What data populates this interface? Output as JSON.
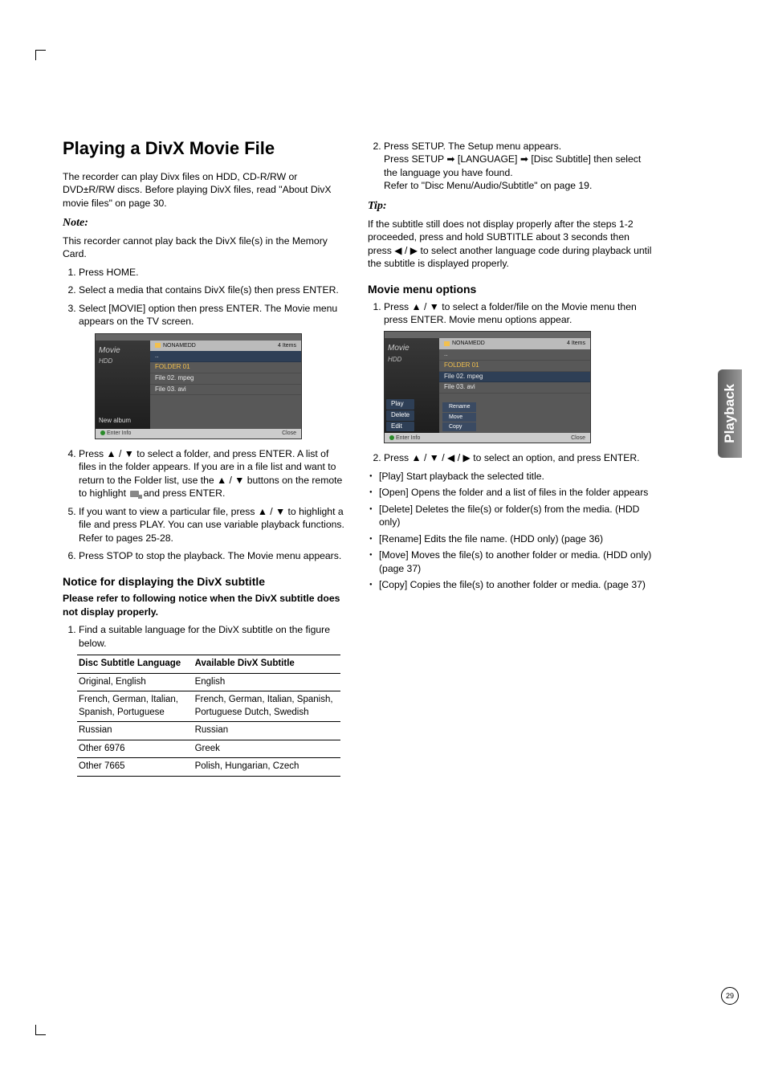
{
  "page": {
    "number": "29",
    "sidetab": "Playback"
  },
  "left": {
    "title": "Playing a DivX Movie File",
    "intro": "The recorder can play Divx files on HDD, CD-R/RW or DVD±R/RW discs. Before playing DivX files, read \"About DivX movie files\" on page 30.",
    "note_label": "Note:",
    "note_text": "This recorder cannot play back the DivX file(s) in the Memory Card.",
    "steps": [
      "Press HOME.",
      "Select a media that contains DivX file(s) then press ENTER.",
      "Select [MOVIE] option then press ENTER. The Movie menu appears on the TV screen."
    ],
    "step4_pre": "Press ▲ / ▼ to select a folder, and press ENTER. A list of files in the folder appears. If you are in a file list and want to return to the Folder list, use the ▲ / ▼ buttons on the remote to highlight ",
    "step4_post": " and press ENTER.",
    "folder_up_icon_name": "folder-up-icon",
    "step5": "If you want to view a particular file, press ▲ / ▼ to highlight a file and press PLAY. You can use variable playback functions. Refer to pages 25-28.",
    "step6": "Press STOP to stop the playback. The Movie menu appears.",
    "notice_heading": "Notice for displaying the DivX subtitle",
    "notice_bold": "Please refer to following notice when the DivX subtitle does not display properly.",
    "notice_step1": "Find a suitable language for the DivX subtitle on the figure below.",
    "table": {
      "h1": "Disc Subtitle Language",
      "h2": "Available DivX Subtitle",
      "rows": [
        {
          "a": "Original, English",
          "b": "English"
        },
        {
          "a": "French, German, Italian, Spanish, Portuguese",
          "b": "French, German, Italian, Spanish, Portuguese Dutch, Swedish"
        },
        {
          "a": "Russian",
          "b": "Russian"
        },
        {
          "a": "Other 6976",
          "b": "Greek"
        },
        {
          "a": "Other 7665",
          "b": "Polish, Hungarian, Czech"
        }
      ]
    },
    "screenshot1": {
      "title_left1": "Movie",
      "title_left2": "HDD",
      "newalbum": "New album",
      "hdr_left": "NONAMEDD",
      "hdr_right": "4 Items",
      "rows": [
        "..",
        "FOLDER 01",
        "File 02. mpeg",
        "File 03. avi"
      ],
      "foot_left": "Enter         Info",
      "foot_right": "Close"
    }
  },
  "right": {
    "step2_line1": "Press SETUP. The Setup menu appears.",
    "step2_line2": "Press SETUP ➡ [LANGUAGE] ➡ [Disc Subtitle] then select the language you have found.",
    "step2_line3": "Refer to \"Disc Menu/Audio/Subtitle\" on page 19.",
    "tip_label": "Tip:",
    "tip_text": "If the subtitle still does not display properly after the steps 1-2 proceeded, press and hold SUBTITLE about 3 seconds then press ◀ / ▶ to select another language code during playback until the subtitle is displayed properly.",
    "mm_heading": "Movie menu options",
    "mm_step1": "Press ▲ / ▼ to select a folder/file on the Movie menu then press ENTER. Movie menu options appear.",
    "mm_step2": "Press ▲ / ▼ / ◀ / ▶ to select an option, and press ENTER.",
    "bullets": [
      "[Play] Start playback the selected title.",
      "[Open] Opens the folder and a list of files in the folder appears",
      "[Delete] Deletes the file(s) or folder(s) from the media. (HDD only)",
      "[Rename] Edits the file name. (HDD only) (page 36)",
      "[Move] Moves the file(s) to another folder or media. (HDD only) (page 37)",
      "[Copy] Copies the file(s) to another folder or media. (page 37)"
    ],
    "screenshot2": {
      "title_left1": "Movie",
      "title_left2": "HDD",
      "opts": [
        "Play",
        "Delete",
        "Edit"
      ],
      "hdr_left": "NONAMEDD",
      "hdr_right": "4 Items",
      "rows": [
        "..",
        "FOLDER 01",
        "File 02. mpeg",
        "File 03. avi"
      ],
      "submenu": [
        "Rename",
        "Move",
        "Copy"
      ],
      "foot_left": "Enter         Info",
      "foot_right": "Close"
    }
  }
}
